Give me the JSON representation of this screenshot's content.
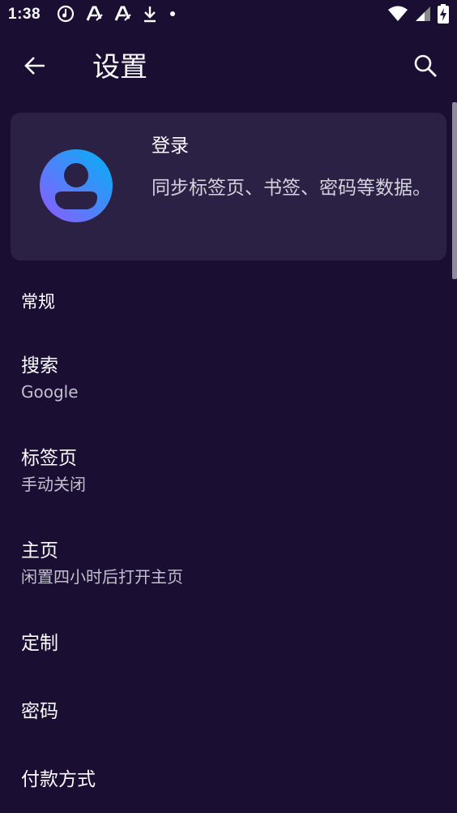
{
  "status_bar": {
    "time": "1:38"
  },
  "app_bar": {
    "title": "设置",
    "back_icon": "arrow-left-icon",
    "search_icon": "search-icon"
  },
  "account_card": {
    "title": "登录",
    "description": "同步标签页、书签、密码等数据。",
    "avatar_icon": "account-avatar-icon"
  },
  "sections": {
    "general_header": "常规"
  },
  "items": [
    {
      "title": "搜索",
      "summary": "Google"
    },
    {
      "title": "标签页",
      "summary": "手动关闭"
    },
    {
      "title": "主页",
      "summary": "闲置四小时后打开主页"
    },
    {
      "title": "定制",
      "summary": ""
    },
    {
      "title": "密码",
      "summary": ""
    },
    {
      "title": "付款方式",
      "summary": ""
    }
  ],
  "colors": {
    "background": "#1a0f33",
    "card": "#2b2145",
    "text": "#fbfbfe",
    "secondary_text": "#c2bfcf",
    "avatar_gradient_start": "#00b3f4",
    "avatar_gradient_end": "#9059ff"
  }
}
